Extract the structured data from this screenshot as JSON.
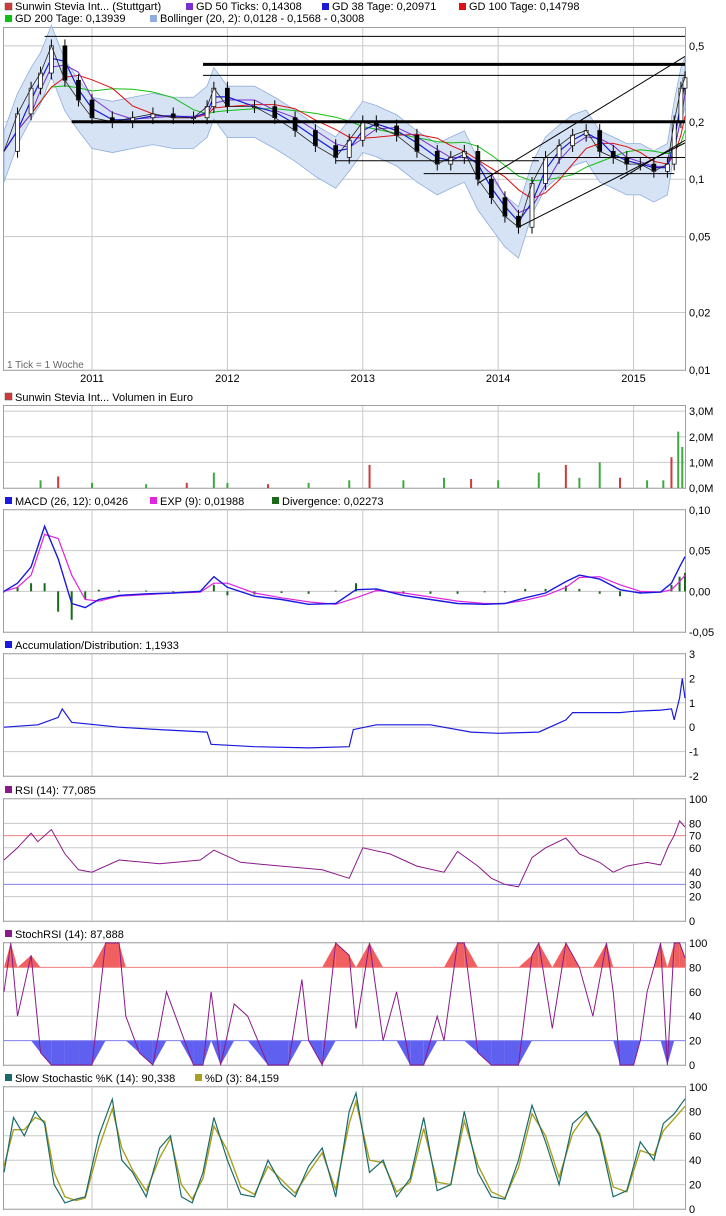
{
  "colors": {
    "grid": "#c8c8c8",
    "border": "#a0a0a0",
    "candle_up": "#ffffff",
    "candle_down": "#000000",
    "bollinger_fill": "#d6e3f5",
    "bollinger_line": "#8faedb",
    "gd50": "#7a2fd0",
    "gd38": "#1b1bd8",
    "gd100": "#e01010",
    "gd200": "#10c010",
    "volume_up": "#3fa83f",
    "volume_down": "#d03a3a",
    "macd": "#1a1ae0",
    "exp": "#e024e0",
    "divergence": "#1a6a1a",
    "ad": "#1a1ae0",
    "rsi": "#8a1a8a",
    "rsi_ob": "#f08080",
    "rsi_os": "#8080f0",
    "stochrsi": "#8a1a8a",
    "stoch_k": "#1a6a6a",
    "stoch_d": "#a8a020"
  },
  "chart_data": [
    {
      "id": "price",
      "type": "line",
      "scale": "log",
      "ylim": [
        0.01,
        0.62
      ],
      "y_ticks": [
        "0,5",
        "0,2",
        "0,1",
        "0,05",
        "0,02",
        "0,01"
      ],
      "y_tick_values": [
        0.5,
        0.2,
        0.1,
        0.05,
        0.02,
        0.01
      ],
      "x_tick_labels": [
        "2011",
        "2012",
        "2013",
        "2014",
        "2015"
      ],
      "x_tick_dates": [
        2011.0,
        2012.0,
        2013.0,
        2014.0,
        2015.0
      ],
      "x_range": [
        2010.35,
        2015.38
      ],
      "note": "1 Tick = 1 Woche",
      "legend": [
        {
          "label": "Sunwin Stevia Int... (Stuttgart)",
          "color_key": "candle_down"
        },
        {
          "label": "GD 50 Ticks: 0,14308",
          "color_key": "gd50"
        },
        {
          "label": "GD 38 Tage: 0,20971",
          "color_key": "gd38"
        },
        {
          "label": "GD 100 Tage: 0,14798",
          "color_key": "gd100"
        },
        {
          "label": "GD 200 Tage: 0,13939",
          "color_key": "gd200"
        },
        {
          "label": "Bollinger (20, 2): 0,0128 - 0,1568 - 0,3008",
          "color_key": "bollinger_line"
        }
      ],
      "close": {
        "x": [
          2010.35,
          2010.45,
          2010.55,
          2010.62,
          2010.7,
          2010.8,
          2010.9,
          2011.0,
          2011.15,
          2011.3,
          2011.45,
          2011.6,
          2011.75,
          2011.85,
          2011.9,
          2012.0,
          2012.2,
          2012.35,
          2012.5,
          2012.65,
          2012.8,
          2012.9,
          2013.0,
          2013.1,
          2013.25,
          2013.4,
          2013.55,
          2013.65,
          2013.75,
          2013.85,
          2013.95,
          2014.05,
          2014.15,
          2014.25,
          2014.35,
          2014.45,
          2014.55,
          2014.65,
          2014.75,
          2014.85,
          2014.95,
          2015.05,
          2015.15,
          2015.25,
          2015.3,
          2015.35,
          2015.38
        ],
        "y": [
          0.14,
          0.22,
          0.3,
          0.36,
          0.5,
          0.33,
          0.26,
          0.21,
          0.2,
          0.21,
          0.22,
          0.21,
          0.21,
          0.24,
          0.3,
          0.24,
          0.24,
          0.21,
          0.18,
          0.15,
          0.13,
          0.16,
          0.2,
          0.19,
          0.17,
          0.14,
          0.12,
          0.13,
          0.14,
          0.1,
          0.08,
          0.064,
          0.056,
          0.095,
          0.13,
          0.15,
          0.17,
          0.18,
          0.14,
          0.13,
          0.12,
          0.12,
          0.11,
          0.12,
          0.2,
          0.3,
          0.34
        ]
      },
      "hlines": [
        {
          "y": 0.56,
          "x0": 2010.65,
          "x1": 2015.38,
          "weight": "thin"
        },
        {
          "y": 0.4,
          "x0": 2011.82,
          "x1": 2015.38,
          "weight": "thick"
        },
        {
          "y": 0.35,
          "x0": 2011.82,
          "x1": 2015.38,
          "weight": "thin"
        },
        {
          "y": 0.2,
          "x0": 2010.85,
          "x1": 2015.38,
          "weight": "thick"
        },
        {
          "y": 0.125,
          "x0": 2012.8,
          "x1": 2014.3,
          "weight": "thin"
        },
        {
          "y": 0.13,
          "x0": 2014.25,
          "x1": 2015.38,
          "weight": "thin"
        },
        {
          "y": 0.107,
          "x0": 2013.45,
          "x1": 2015.3,
          "weight": "thin"
        }
      ],
      "trendlines": [
        {
          "x0": 2013.85,
          "y0": 0.095,
          "x1": 2015.38,
          "y1": 0.44
        },
        {
          "x0": 2014.15,
          "y0": 0.056,
          "x1": 2015.38,
          "y1": 0.155
        },
        {
          "x0": 2014.9,
          "y0": 0.1,
          "x1": 2015.38,
          "y1": 0.16
        }
      ]
    },
    {
      "id": "volume",
      "type": "bar",
      "title": "Sunwin Stevia Int... Volumen in Euro",
      "ylim": [
        0,
        3.2
      ],
      "y_ticks": [
        "3,0M",
        "2,0M",
        "1,0M",
        "0,0M"
      ],
      "y_tick_values": [
        3.0,
        2.0,
        1.0,
        0.0
      ],
      "x": [
        2010.62,
        2010.75,
        2011.0,
        2011.4,
        2011.7,
        2011.9,
        2012.0,
        2012.3,
        2012.6,
        2012.9,
        2013.05,
        2013.3,
        2013.6,
        2013.8,
        2014.0,
        2014.3,
        2014.5,
        2014.6,
        2014.75,
        2014.9,
        2015.1,
        2015.22,
        2015.28,
        2015.33,
        2015.36
      ],
      "values": [
        0.3,
        0.45,
        0.2,
        0.15,
        0.2,
        0.6,
        0.2,
        0.15,
        0.2,
        0.3,
        0.9,
        0.3,
        0.4,
        0.35,
        0.3,
        0.6,
        0.9,
        0.4,
        1.0,
        0.4,
        0.3,
        0.3,
        1.2,
        2.2,
        1.6
      ]
    },
    {
      "id": "macd",
      "type": "line",
      "ylim": [
        -0.05,
        0.1
      ],
      "y_ticks": [
        "0,10",
        "0,05",
        "0,00",
        "-0,05"
      ],
      "y_tick_values": [
        0.1,
        0.05,
        0.0,
        -0.05
      ],
      "legend": [
        {
          "label": "MACD (26, 12): 0,0426",
          "color_key": "macd"
        },
        {
          "label": "EXP (9): 0,01988",
          "color_key": "exp"
        },
        {
          "label": "Divergence: 0,02273",
          "color_key": "divergence"
        }
      ],
      "x": [
        2010.35,
        2010.45,
        2010.55,
        2010.65,
        2010.75,
        2010.85,
        2010.95,
        2011.05,
        2011.2,
        2011.4,
        2011.6,
        2011.8,
        2011.9,
        2012.0,
        2012.2,
        2012.4,
        2012.6,
        2012.8,
        2012.95,
        2013.1,
        2013.3,
        2013.5,
        2013.7,
        2013.9,
        2014.05,
        2014.2,
        2014.35,
        2014.5,
        2014.6,
        2014.75,
        2014.9,
        2015.05,
        2015.2,
        2015.28,
        2015.34,
        2015.38
      ],
      "macd": [
        0.0,
        0.01,
        0.03,
        0.08,
        0.04,
        -0.015,
        -0.02,
        -0.01,
        -0.005,
        -0.003,
        -0.002,
        0.0,
        0.018,
        0.005,
        -0.006,
        -0.01,
        -0.016,
        -0.015,
        0.002,
        0.003,
        -0.005,
        -0.01,
        -0.015,
        -0.016,
        -0.015,
        -0.008,
        -0.002,
        0.012,
        0.02,
        0.015,
        0.002,
        -0.002,
        -0.001,
        0.01,
        0.03,
        0.0426
      ],
      "exp": [
        0.0,
        0.005,
        0.02,
        0.07,
        0.065,
        0.02,
        -0.01,
        -0.012,
        -0.006,
        -0.004,
        -0.002,
        -0.001,
        0.01,
        0.01,
        -0.002,
        -0.008,
        -0.013,
        -0.016,
        -0.008,
        0.001,
        -0.002,
        -0.007,
        -0.012,
        -0.015,
        -0.015,
        -0.011,
        -0.005,
        0.005,
        0.017,
        0.018,
        0.008,
        0.0,
        -0.001,
        0.002,
        0.012,
        0.01988
      ]
    },
    {
      "id": "ad",
      "type": "line",
      "title": "Accumulation/Distribution: 1,1933",
      "ylim": [
        -2,
        3
      ],
      "y_ticks": [
        "3",
        "2",
        "1",
        "0",
        "-1",
        "-2"
      ],
      "y_tick_values": [
        3,
        2,
        1,
        0,
        -1,
        -2
      ],
      "x": [
        2010.35,
        2010.6,
        2010.75,
        2010.78,
        2010.85,
        2011.2,
        2011.5,
        2011.85,
        2011.88,
        2012.2,
        2012.6,
        2012.9,
        2012.93,
        2013.1,
        2013.5,
        2013.8,
        2014.0,
        2014.3,
        2014.5,
        2014.55,
        2014.9,
        2015.0,
        2015.2,
        2015.28,
        2015.3,
        2015.34,
        2015.36,
        2015.38
      ],
      "y": [
        0.0,
        0.1,
        0.4,
        0.75,
        0.2,
        0.0,
        -0.1,
        -0.2,
        -0.7,
        -0.8,
        -0.85,
        -0.8,
        -0.1,
        0.1,
        0.1,
        -0.2,
        -0.25,
        -0.2,
        0.3,
        0.6,
        0.6,
        0.65,
        0.7,
        0.75,
        0.3,
        1.2,
        2.0,
        1.19
      ]
    },
    {
      "id": "rsi",
      "type": "line",
      "title": "RSI (14): 77,085",
      "ylim": [
        0,
        100
      ],
      "y_ticks": [
        "100",
        "80",
        "70",
        "60",
        "40",
        "30",
        "20",
        "0"
      ],
      "y_tick_values": [
        100,
        80,
        70,
        60,
        40,
        30,
        20,
        0
      ],
      "overbought": 70,
      "oversold": 30,
      "x": [
        2010.35,
        2010.45,
        2010.55,
        2010.6,
        2010.7,
        2010.8,
        2010.9,
        2011.0,
        2011.2,
        2011.5,
        2011.8,
        2011.9,
        2012.1,
        2012.4,
        2012.7,
        2012.9,
        2013.0,
        2013.2,
        2013.4,
        2013.6,
        2013.7,
        2013.85,
        2013.95,
        2014.05,
        2014.15,
        2014.25,
        2014.35,
        2014.5,
        2014.6,
        2014.75,
        2014.85,
        2014.95,
        2015.1,
        2015.2,
        2015.26,
        2015.3,
        2015.34,
        2015.38
      ],
      "y": [
        50,
        60,
        72,
        65,
        75,
        55,
        42,
        40,
        50,
        47,
        50,
        58,
        48,
        45,
        42,
        35,
        60,
        55,
        45,
        40,
        57,
        45,
        35,
        30,
        28,
        52,
        60,
        68,
        55,
        48,
        40,
        45,
        48,
        46,
        62,
        70,
        82,
        77.085
      ]
    },
    {
      "id": "stochrsi",
      "type": "line",
      "title": "StochRSI (14): 87,888",
      "ylim": [
        0,
        100
      ],
      "y_ticks": [
        "100",
        "80",
        "60",
        "40",
        "20",
        "0"
      ],
      "y_tick_values": [
        100,
        80,
        60,
        40,
        20,
        0
      ],
      "overbought": 80,
      "oversold": 20,
      "x": [
        2010.35,
        2010.4,
        2010.45,
        2010.55,
        2010.62,
        2010.7,
        2010.8,
        2010.9,
        2011.0,
        2011.1,
        2011.2,
        2011.25,
        2011.35,
        2011.45,
        2011.55,
        2011.65,
        2011.75,
        2011.82,
        2011.88,
        2011.95,
        2012.05,
        2012.15,
        2012.3,
        2012.45,
        2012.55,
        2012.6,
        2012.7,
        2012.8,
        2012.9,
        2012.95,
        2013.05,
        2013.15,
        2013.25,
        2013.35,
        2013.45,
        2013.55,
        2013.6,
        2013.7,
        2013.75,
        2013.85,
        2013.95,
        2014.05,
        2014.15,
        2014.25,
        2014.3,
        2014.4,
        2014.5,
        2014.6,
        2014.7,
        2014.8,
        2014.85,
        2014.9,
        2015.0,
        2015.05,
        2015.1,
        2015.15,
        2015.2,
        2015.25,
        2015.3,
        2015.34,
        2015.38
      ],
      "y": [
        60,
        100,
        40,
        90,
        10,
        0,
        0,
        0,
        0,
        100,
        100,
        40,
        10,
        0,
        60,
        30,
        0,
        0,
        60,
        0,
        50,
        40,
        0,
        0,
        70,
        20,
        0,
        100,
        90,
        30,
        100,
        20,
        60,
        0,
        0,
        40,
        20,
        100,
        100,
        10,
        0,
        0,
        0,
        90,
        100,
        30,
        100,
        80,
        40,
        100,
        60,
        0,
        0,
        20,
        60,
        80,
        100,
        0,
        100,
        100,
        87.888
      ]
    },
    {
      "id": "stoch",
      "type": "line",
      "ylim": [
        0,
        100
      ],
      "y_ticks": [
        "100",
        "80",
        "60",
        "40",
        "20",
        "0"
      ],
      "y_tick_values": [
        100,
        80,
        60,
        40,
        20,
        0
      ],
      "legend": [
        {
          "label": "Slow Stochastic %K (14): 90,338",
          "color_key": "stoch_k"
        },
        {
          "label": "%D (3): 84,159",
          "color_key": "stoch_d"
        }
      ],
      "x": [
        2010.35,
        2010.42,
        2010.5,
        2010.58,
        2010.65,
        2010.72,
        2010.8,
        2010.88,
        2010.95,
        2011.05,
        2011.15,
        2011.22,
        2011.3,
        2011.4,
        2011.5,
        2011.58,
        2011.66,
        2011.74,
        2011.82,
        2011.9,
        2012.0,
        2012.1,
        2012.2,
        2012.3,
        2012.4,
        2012.5,
        2012.6,
        2012.7,
        2012.8,
        2012.9,
        2012.95,
        2013.05,
        2013.15,
        2013.25,
        2013.35,
        2013.45,
        2013.55,
        2013.65,
        2013.75,
        2013.85,
        2013.95,
        2014.05,
        2014.15,
        2014.25,
        2014.35,
        2014.45,
        2014.55,
        2014.65,
        2014.75,
        2014.85,
        2014.95,
        2015.05,
        2015.15,
        2015.22,
        2015.3,
        2015.38
      ],
      "k": [
        30,
        75,
        60,
        80,
        70,
        20,
        5,
        8,
        10,
        60,
        90,
        40,
        30,
        10,
        50,
        60,
        10,
        5,
        30,
        75,
        40,
        12,
        10,
        40,
        20,
        10,
        35,
        50,
        10,
        80,
        95,
        30,
        40,
        10,
        25,
        75,
        15,
        20,
        80,
        30,
        10,
        8,
        40,
        85,
        55,
        20,
        70,
        80,
        60,
        10,
        15,
        55,
        40,
        70,
        78,
        90.338
      ],
      "d": [
        35,
        65,
        65,
        75,
        72,
        30,
        10,
        7,
        9,
        50,
        82,
        50,
        32,
        15,
        42,
        58,
        20,
        8,
        25,
        68,
        48,
        18,
        12,
        35,
        24,
        13,
        30,
        46,
        16,
        70,
        88,
        40,
        38,
        14,
        22,
        66,
        22,
        20,
        72,
        36,
        14,
        9,
        34,
        78,
        60,
        26,
        62,
        78,
        62,
        18,
        14,
        48,
        44,
        64,
        74,
        84.159
      ]
    }
  ]
}
